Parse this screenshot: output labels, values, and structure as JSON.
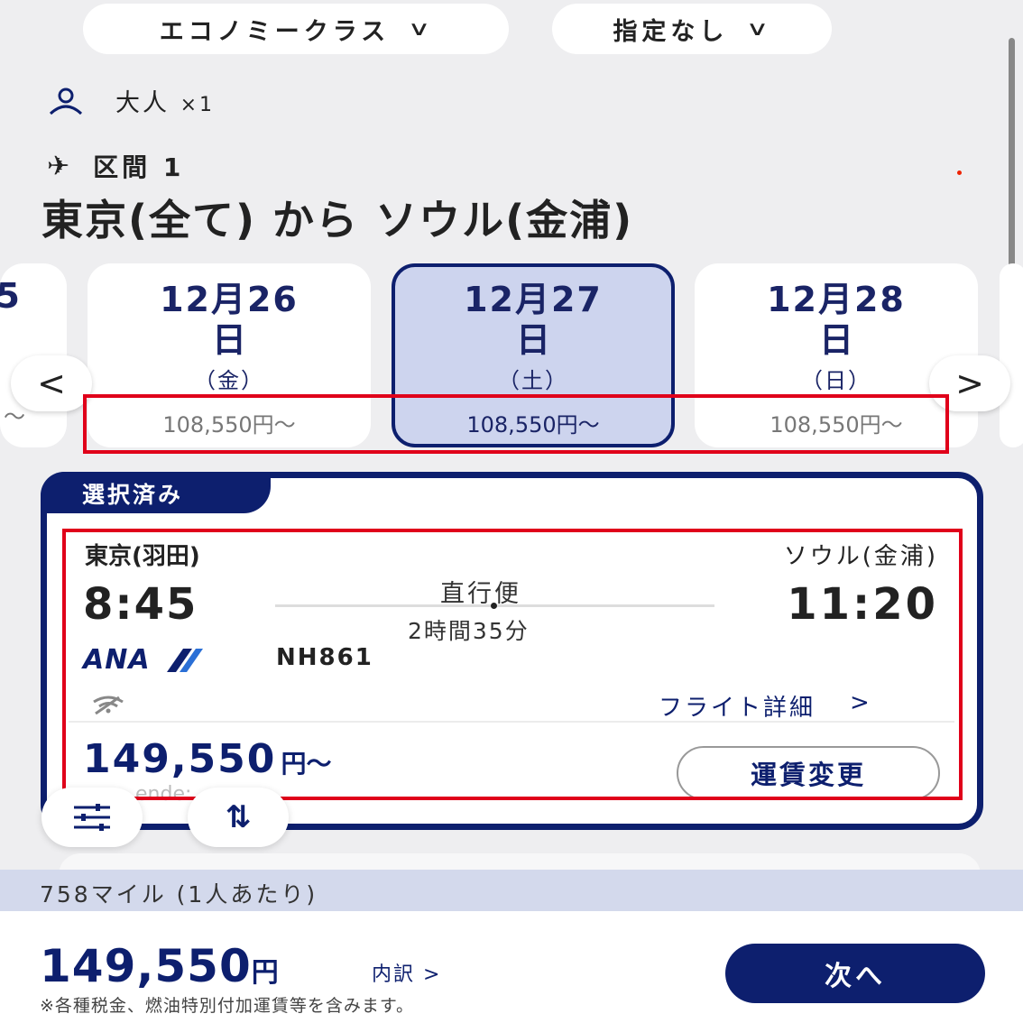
{
  "filters": {
    "cabin": "エコノミークラス",
    "option": "指定なし"
  },
  "passengers": {
    "label": "大人",
    "count": "×1"
  },
  "segment": {
    "label": "区間 1"
  },
  "route": {
    "title": "東京(全て) から ソウル(金浦)"
  },
  "dates": [
    {
      "md": "5",
      "day": "",
      "wd": "",
      "price": "～"
    },
    {
      "md": "12月26",
      "day": "日",
      "wd": "（金）",
      "price": "108,550円～"
    },
    {
      "md": "12月27",
      "day": "日",
      "wd": "（土）",
      "price": "108,550円～",
      "selected": true
    },
    {
      "md": "12月28",
      "day": "日",
      "wd": "（日）",
      "price": "108,550円～"
    }
  ],
  "selected_flight": {
    "tab": "選択済み",
    "from": "東京(羽田)",
    "to": "ソウル(金浦)",
    "depart": "8:45",
    "arrive": "11:20",
    "type": "直行便",
    "duration": "2時間35分",
    "airline": "ANA",
    "flight_no": "NH861",
    "details_link": "フライト詳細",
    "fare": "149,550",
    "fare_suffix": "円～",
    "fare_change": "運賃変更",
    "obscured_text": "ende:"
  },
  "miles": "758マイル (1人あたり)",
  "total": {
    "amount": "149,550",
    "unit": "円",
    "breakdown": "内訳 >",
    "note": "※各種税金、燃油特別付加運賃等を含みます。",
    "next": "次へ"
  },
  "colors": {
    "navy": "#0d1f6e",
    "highlight": "#e0001a",
    "selected_bg": "#cdd4ee"
  }
}
